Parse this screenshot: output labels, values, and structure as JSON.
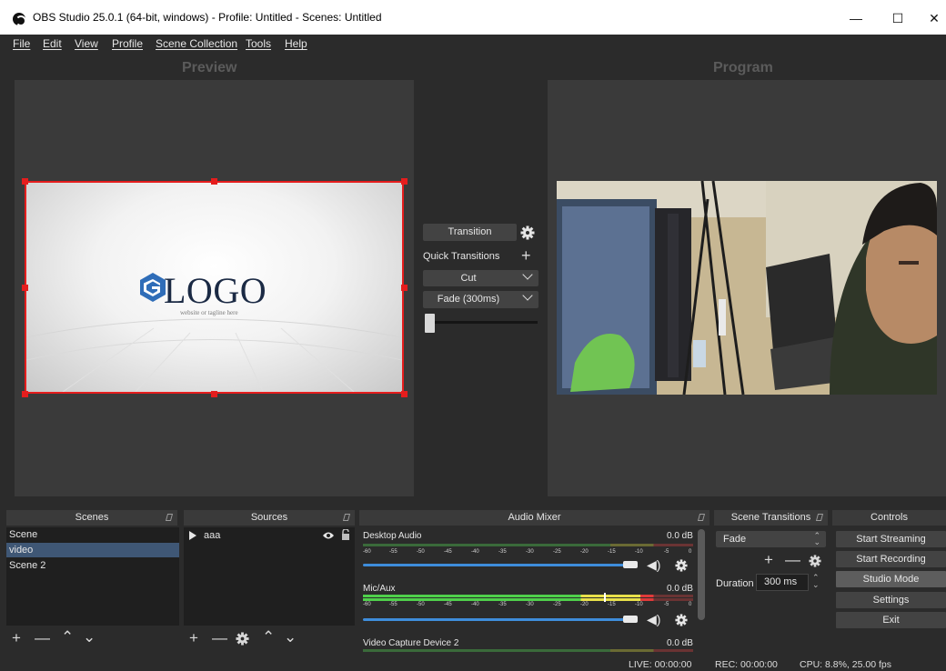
{
  "window": {
    "title": "OBS Studio 25.0.1 (64-bit, windows) - Profile: Untitled - Scenes: Untitled",
    "minimize_glyph": "—",
    "maximize_glyph": "☐",
    "close_glyph": "✕"
  },
  "menu": [
    {
      "label": "File"
    },
    {
      "label": "Edit"
    },
    {
      "label": "View"
    },
    {
      "label": "Profile"
    },
    {
      "label": "Scene Collection"
    },
    {
      "label": "Tools"
    },
    {
      "label": "Help"
    }
  ],
  "preview": {
    "label": "Preview",
    "logo_text": "LOGO",
    "logo_tagline": "website or tagline here"
  },
  "program": {
    "label": "Program"
  },
  "transition_panel": {
    "transition_button": "Transition",
    "quick_transitions_label": "Quick Transitions",
    "quick_items": [
      {
        "label": "Cut"
      },
      {
        "label": "Fade (300ms)"
      }
    ],
    "slider_value": 0
  },
  "scenes": {
    "title": "Scenes",
    "items": [
      {
        "label": "Scene",
        "selected": false
      },
      {
        "label": "video",
        "selected": true
      },
      {
        "label": "Scene 2",
        "selected": false
      }
    ]
  },
  "sources": {
    "title": "Sources",
    "items": [
      {
        "label": "aaa",
        "visible": true,
        "locked": false
      }
    ]
  },
  "audio_mixer": {
    "title": "Audio Mixer",
    "tick_labels": [
      "-60",
      "-55",
      "-50",
      "-45",
      "-40",
      "-35",
      "-30",
      "-25",
      "-20",
      "-15",
      "-10",
      "-5",
      "0"
    ],
    "channels": [
      {
        "name": "Desktop Audio",
        "db": "0.0 dB",
        "level": 0.0,
        "volume": 1.0
      },
      {
        "name": "Mic/Aux",
        "db": "0.0 dB",
        "level": 0.88,
        "volume": 1.0
      },
      {
        "name": "Video Capture Device 2",
        "db": "0.0 dB",
        "level": 0.0,
        "volume": 1.0
      }
    ]
  },
  "scene_transitions": {
    "title": "Scene Transitions",
    "selected": "Fade",
    "duration_label": "Duration",
    "duration_value": "300 ms"
  },
  "controls": {
    "title": "Controls",
    "buttons": [
      {
        "label": "Start Streaming",
        "active": false
      },
      {
        "label": "Start Recording",
        "active": false
      },
      {
        "label": "Studio Mode",
        "active": true
      },
      {
        "label": "Settings",
        "active": false
      },
      {
        "label": "Exit",
        "active": false
      }
    ]
  },
  "status": {
    "live": "LIVE: 00:00:00",
    "rec": "REC: 00:00:00",
    "cpu": "CPU: 8.8%, 25.00 fps"
  },
  "colors": {
    "background": "#2b2b2b",
    "selection_red": "#e51d1d",
    "volume_blue": "#3e8ddb",
    "meter_green": "#4fd04b",
    "meter_yellow": "#e8e04a",
    "meter_red": "#e03a3a",
    "selected_row": "#3f5775"
  }
}
